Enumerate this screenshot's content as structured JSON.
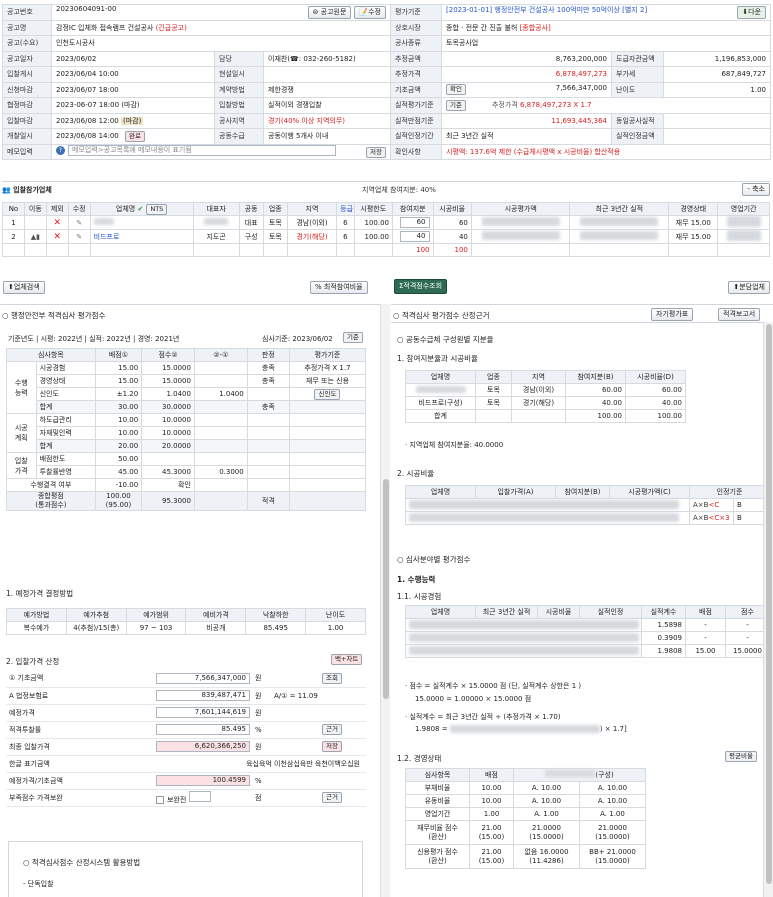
{
  "info": {
    "rows": [
      [
        "공고번호",
        "20230604091-00",
        "",
        "",
        "평가기준",
        "[2023-01-01] 행정안전부 건설공사 100억미만 50억이상 [별지 2]",
        "",
        ""
      ],
      [
        "공고명",
        "감정IC 입체화 접속램프 건설공사 (긴급공고)",
        "",
        "",
        "상호시장",
        "종합 · 전문 간 진출 불허 [종합공사]",
        "",
        ""
      ],
      [
        "공고(수요)",
        "인천도시공사",
        "",
        "",
        "공사종류",
        "토목공사업",
        "",
        ""
      ],
      [
        "공고일자",
        "2023/06/02",
        "담당",
        "이재찬(☎: 032-260-5182)",
        "추정금액",
        "8,763,200,000",
        "도급자관금액",
        "1,196,853,000"
      ],
      [
        "입찰게시",
        "2023/06/04 10:00",
        "현설일시",
        "",
        "추정가격",
        "6,878,497,273",
        "부가세",
        "687,849,727"
      ],
      [
        "신청마감",
        "2023/06/07 18:00",
        "계약방법",
        "제한경쟁",
        "기초금액",
        "7,566,347,000",
        "난이도",
        "1.00"
      ],
      [
        "협정마감",
        "2023-06-07 18:00  (마감)",
        "입찰방법",
        "실적이외 경쟁입찰",
        "실적평가기준",
        "추정가격 6,878,497,273 X 1.7",
        "",
        ""
      ],
      [
        "입찰마감",
        "2023/06/08 12:00  (마감)",
        "공사지역",
        "경기(40% 이상 지역의무)",
        "실적만점기준",
        "11,693,445,364",
        "동일공사실적",
        ""
      ],
      [
        "개찰일시",
        "2023/06/08 14:00",
        "공동수급",
        "공동이행 5개사 이내",
        "실적인정기간",
        "최근 3년간 실적",
        "실적인정금액",
        ""
      ],
      [
        "메모입력",
        "메모입력>공고목록에 메모내용이 표기됨",
        "",
        "",
        "확인사항",
        "시평액: 137.6억 제한 (수급체시평액 x 시공비율) 합산적용",
        "",
        ""
      ]
    ],
    "btn_origin": "공고원문",
    "btn_edit": "수정",
    "btn_down": "다운",
    "btn_confirm": "확인",
    "btn_criteria": "기준",
    "btn_save": "저장",
    "tag_done": "완료"
  },
  "part": {
    "title": "입찰참가업체",
    "region_share": "지역업체 참여지분: 40%",
    "collapse": "- 축소",
    "headers": [
      "No",
      "이동",
      "제외",
      "수정",
      "업체명",
      "NTS",
      "대표자",
      "공동",
      "업종",
      "지역",
      "등급",
      "시평한도",
      "참여지분",
      "시공비율",
      "시공평가액",
      "최근 3년간 실적",
      "경영상태",
      "영업기간"
    ],
    "rows": [
      [
        "1",
        "",
        "",
        "",
        "",
        "",
        "",
        "대표",
        "토목",
        "경남(이외)",
        "6",
        "100.00",
        "60",
        "60",
        "",
        "",
        "재무 15.00",
        ""
      ],
      [
        "2",
        "",
        "",
        "",
        "비드프로",
        "",
        "지도곤",
        "구성",
        "토목",
        "경기(해당)",
        "6",
        "100.00",
        "40",
        "40",
        "",
        "",
        "재무 15.00",
        ""
      ]
    ],
    "total_share": "100",
    "total_ratio": "100"
  },
  "bar": {
    "search": "업체검색",
    "optimal": "% 최적참여비율",
    "calc": "Σ적격점수조회",
    "share": "분담업체"
  },
  "left": {
    "title": "행정안전부 적격심사 평가점수",
    "sub": "기준년도 | 시평: 2022년 | 실적: 2022년 | 경영: 2021년",
    "exam": "심사기준: 2023/06/02",
    "exam_btn": "기준",
    "headers": [
      "심사항목",
      "배점①",
      "점수②",
      "②-①",
      "판정",
      "평가기준"
    ],
    "g1": "수행능력",
    "g2": "시공계획",
    "g3": "입찰가격",
    "rows": [
      [
        "시공경험",
        "15.00",
        "15.0000",
        "",
        "충족",
        "추정가격 X 1.7"
      ],
      [
        "경영상태",
        "15.00",
        "15.0000",
        "",
        "충족",
        "재무 또는 신용"
      ],
      [
        "신인도",
        "±1.20",
        "1.0400",
        "1.0400",
        "",
        "신인도"
      ],
      [
        "합계",
        "30.00",
        "30.0000",
        "",
        "충족",
        ""
      ],
      [
        "하도급관리",
        "10.00",
        "10.0000",
        "",
        "",
        ""
      ],
      [
        "자재및인력",
        "10.00",
        "10.0000",
        "",
        "",
        ""
      ],
      [
        "합계",
        "20.00",
        "20.0000",
        "",
        "",
        ""
      ],
      [
        "배점한도",
        "50.00",
        "",
        "",
        "",
        ""
      ],
      [
        "투찰률반영",
        "45.00",
        "45.3000",
        "0.3000",
        "",
        ""
      ],
      [
        "수행결격 여부",
        "-10.00",
        "확인",
        "",
        "",
        ""
      ],
      [
        "종합평점\n(통과점수)",
        "100.00\n(95.00)",
        "95.3000",
        "",
        "적격",
        ""
      ]
    ],
    "s1": "1. 예정가격 결정방법",
    "s1h": [
      "예가방법",
      "예가추첨",
      "예가범위",
      "예비가격",
      "낙찰하한",
      "난이도"
    ],
    "s1r": [
      "복수예가",
      "4(추첨)/15(총)",
      "97 ~ 103",
      "비공개",
      "85.495",
      "1.00"
    ],
    "s2": "2. 입찰가격 산정",
    "s2btn": "백+차트",
    "s2rows": [
      [
        "① 기초금액",
        "7,566,347,000",
        "원",
        "조회"
      ],
      [
        "A 법정보험료",
        "839,487,471",
        "원",
        "A/① = 11.09"
      ],
      [
        "예정가격",
        "7,601,144,619",
        "원",
        ""
      ],
      [
        "적격투찰률",
        "85.495",
        "%",
        "근거"
      ],
      [
        "최종 입찰가격",
        "6,620,366,250",
        "원",
        "저장"
      ],
      [
        "한글 표기금액",
        "육십육억 이천삼십육만 육천이백오십원",
        "",
        ""
      ],
      [
        "예정가격/기초금액",
        "100.4599",
        "%",
        ""
      ],
      [
        "부족점수 가격보완",
        "",
        "점",
        "근거"
      ]
    ],
    "supp": "보완전",
    "s3": "○ 적격심사점수 산정시스템 활용방법",
    "s3a": "- 단독입찰"
  },
  "right": {
    "title": "적격심사 평가점수 산정근거",
    "btn1": "자기평가표",
    "btn2": "적격보고서",
    "h1": "○ 공동수급체 구성원별 지분율",
    "h11": "1. 참여지분율과 시공비율",
    "t1h": [
      "업체명",
      "업종",
      "지역",
      "참여지분(B)",
      "시공비율(D)"
    ],
    "t1r": [
      [
        "",
        "토목",
        "경남(이외)",
        "60.00",
        "60.00"
      ],
      [
        "비드프로(구성)",
        "토목",
        "경기(해당)",
        "40.00",
        "40.00"
      ],
      [
        "합계",
        "",
        "",
        "100.00",
        "100.00"
      ]
    ],
    "note1": "· 지역업체 참여지분율: 40.0000",
    "h12": "2. 시공비율",
    "t2h": [
      "업체명",
      "입찰가격(A)",
      "참여지분(B)",
      "시공평가액(C)",
      "인정기준"
    ],
    "t2r": [
      [
        "A×B<C",
        "B"
      ],
      [
        "A×B<C×3",
        "B"
      ]
    ],
    "h2": "○ 심사분야별 평가점수",
    "h21": "1. 수행능력",
    "h22": "1.1. 시공경험",
    "t3h": [
      "업체명",
      "최근 3년간 실적",
      "시공비율",
      "실적인정",
      "실적계수",
      "배점",
      "점수"
    ],
    "t3r": [
      [
        "1.5898",
        "-",
        "-"
      ],
      [
        "0.3909",
        "-",
        "-"
      ],
      [
        "1.9808",
        "15.00",
        "15.0000"
      ]
    ],
    "f1": "· 점수   = 실적계수 × 15.0000 점  (단, 실적계수 상한은 1 )",
    "f2": "15.0000 = 1.00000 × 15.0000 점",
    "f3": "· 실적계수 = 최근 3년간 실적 ÷ (추정가격 × 1.70)",
    "f4a": "1.9808 = ",
    "f4b": ") × 1.7]",
    "h23": "1.2. 경영상태",
    "avg_btn": "평균비율",
    "t4h": [
      "심사항목",
      "배점",
      "(구성)"
    ],
    "t4r": [
      [
        "부채비율",
        "10.00",
        "A. 10.00",
        "A. 10.00"
      ],
      [
        "유동비율",
        "10.00",
        "A. 10.00",
        "A. 10.00"
      ],
      [
        "영업기간",
        "1.00",
        "A.  1.00",
        "A.  1.00"
      ],
      [
        "재무비율 점수\n(환산)",
        "21.00\n(15.00)",
        "21.0000\n(15.0000)",
        "21.0000\n(15.0000)"
      ],
      [
        "신용평가 점수\n(환산)",
        "21.00\n(15.00)",
        "없음 16.0000\n(11.4286)",
        "BB+ 21.0000\n(15.0000)"
      ]
    ]
  }
}
